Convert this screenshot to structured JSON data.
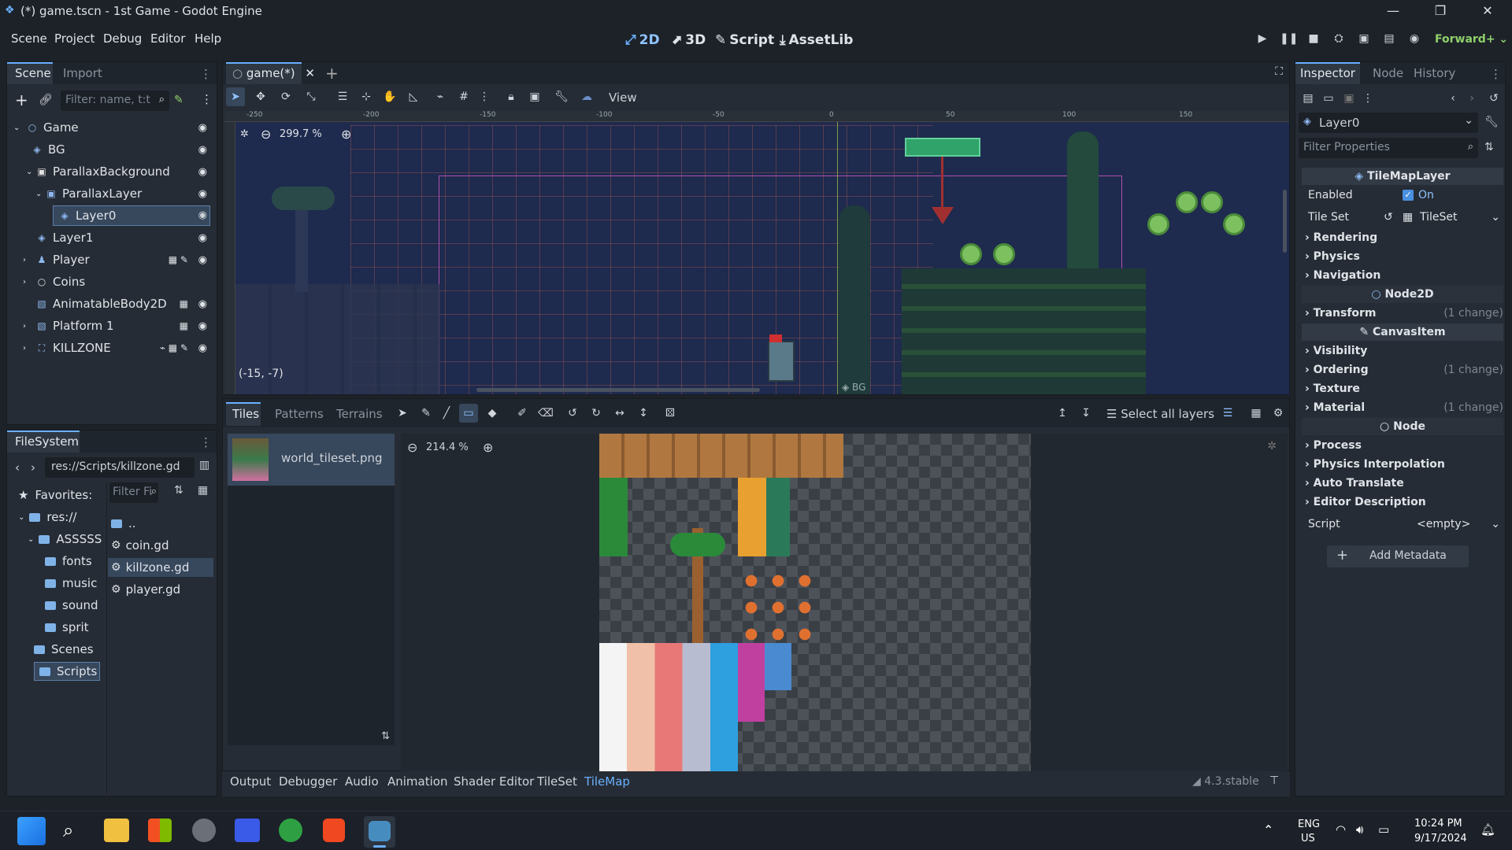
{
  "window": {
    "title": "(*) game.tscn - 1st Game - Godot Engine"
  },
  "menu": [
    "Scene",
    "Project",
    "Debug",
    "Editor",
    "Help"
  ],
  "modes": {
    "m2d": "2D",
    "m3d": "3D",
    "script": "Script",
    "assetlib": "AssetLib"
  },
  "renderer": "Forward+",
  "scene_panel": {
    "tab_scene": "Scene",
    "tab_import": "Import",
    "filter_placeholder": "Filter: name, t:t",
    "nodes": [
      {
        "name": "Game"
      },
      {
        "name": "BG"
      },
      {
        "name": "ParallaxBackground"
      },
      {
        "name": "ParallaxLayer"
      },
      {
        "name": "Layer0"
      },
      {
        "name": "Layer1"
      },
      {
        "name": "Player"
      },
      {
        "name": "Coins"
      },
      {
        "name": "AnimatableBody2D"
      },
      {
        "name": "Platform 1"
      },
      {
        "name": "KILLZONE"
      }
    ]
  },
  "filesystem": {
    "tab": "FileSystem",
    "path": "res://Scripts/killzone.gd",
    "favorites": "Favorites:",
    "filter_placeholder": "Filter Fi",
    "tree": [
      "res://",
      "ASSSSS",
      "fonts",
      "music",
      "sound",
      "sprit",
      "Scenes",
      "Scripts"
    ],
    "files": [
      "..",
      "coin.gd",
      "killzone.gd",
      "player.gd"
    ]
  },
  "viewport": {
    "tab": "game(*)",
    "zoom": "299.7 %",
    "coords": "(-15, -7)",
    "view_label": "View",
    "bg_label": "BG",
    "ruler": [
      "-250",
      "-200",
      "-150",
      "-100",
      "-50",
      "0",
      "50",
      "100",
      "150"
    ]
  },
  "tileset_panel": {
    "tabs": [
      "Tiles",
      "Patterns",
      "Terrains"
    ],
    "select_layers": "Select all layers",
    "source": "world_tileset.png",
    "zoom": "214.4 %"
  },
  "bottom_tabs": [
    "Output",
    "Debugger",
    "Audio",
    "Animation",
    "Shader Editor",
    "TileSet",
    "TileMap"
  ],
  "version": "4.3.stable",
  "inspector": {
    "tabs": [
      "Inspector",
      "Node",
      "History"
    ],
    "object": "Layer0",
    "filter_placeholder": "Filter Properties",
    "class_tilemaplayer": "TileMapLayer",
    "enabled_label": "Enabled",
    "enabled_value": "On",
    "tileset_label": "Tile Set",
    "tileset_value": "TileSet",
    "groups1": [
      "Rendering",
      "Physics",
      "Navigation"
    ],
    "class_node2d": "Node2D",
    "transform": "Transform",
    "change": "(1 change)",
    "class_canvasitem": "CanvasItem",
    "visibility": "Visibility",
    "ordering": "Ordering",
    "texture": "Texture",
    "material": "Material",
    "class_node": "Node",
    "groups2": [
      "Process",
      "Physics Interpolation",
      "Auto Translate",
      "Editor Description"
    ],
    "script_label": "Script",
    "script_value": "<empty>",
    "add_metadata": "Add Metadata"
  },
  "taskbar": {
    "lang1": "ENG",
    "lang2": "US",
    "time": "10:24 PM",
    "date": "9/17/2024"
  }
}
